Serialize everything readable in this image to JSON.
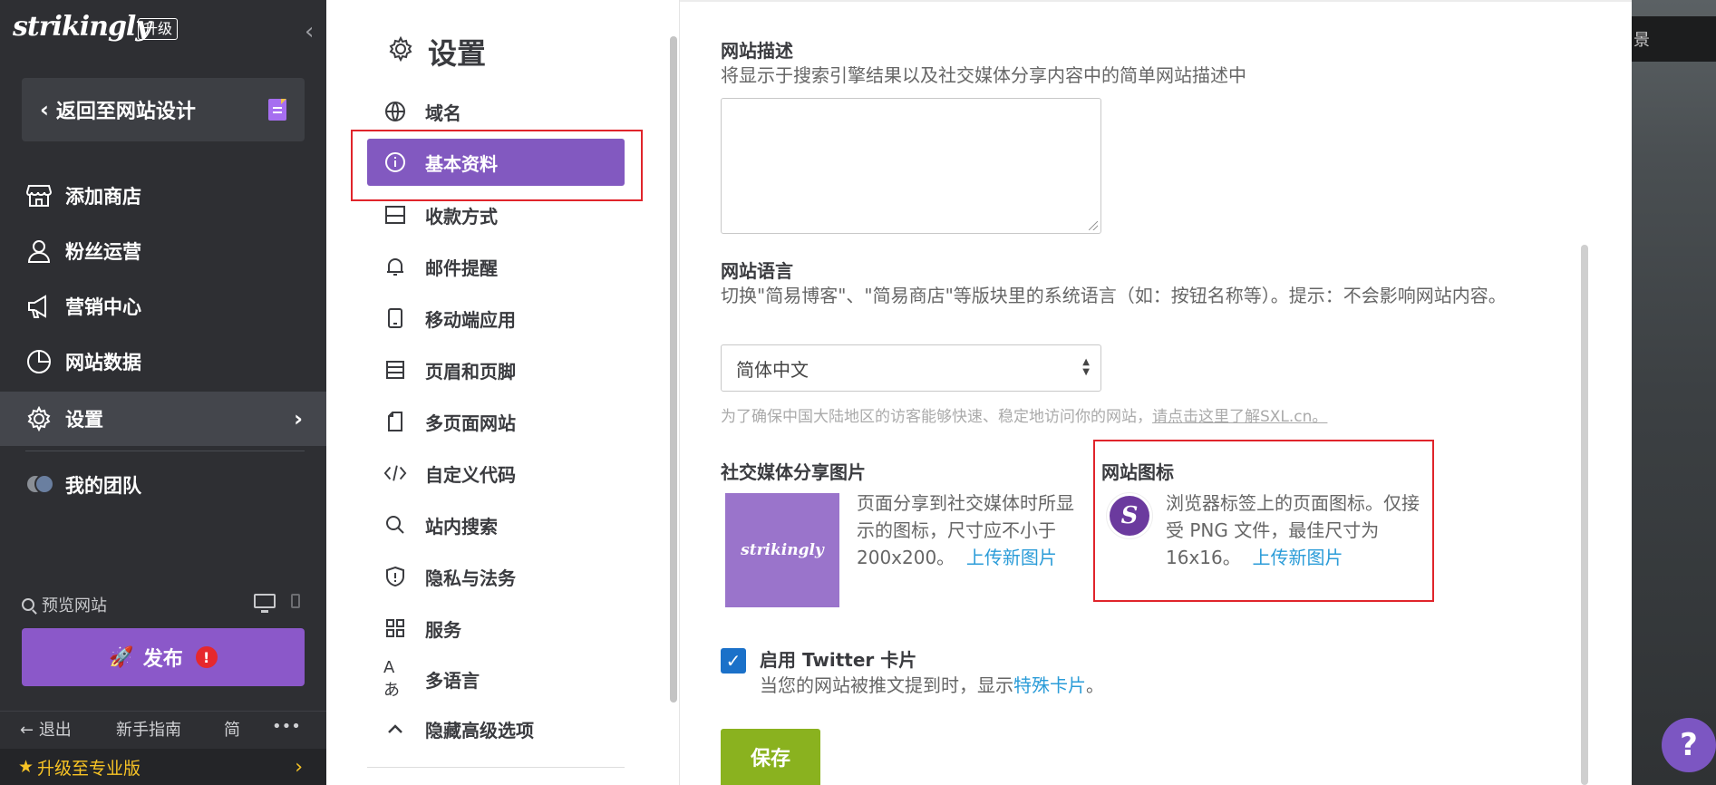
{
  "sidebar": {
    "logo": "strikingly",
    "upgrade_tag": "升级",
    "back_label": "返回至网站设计",
    "items": [
      {
        "label": "添加商店",
        "icon": "store-icon"
      },
      {
        "label": "粉丝运营",
        "icon": "audience-icon"
      },
      {
        "label": "营销中心",
        "icon": "megaphone-icon"
      },
      {
        "label": "网站数据",
        "icon": "pie-chart-icon"
      },
      {
        "label": "设置",
        "icon": "gear-icon"
      },
      {
        "label": "我的团队",
        "icon": "team-avatar-icon"
      }
    ],
    "preview_label": "预览网站",
    "publish_label": "发布",
    "publish_alert": "!",
    "bottom": {
      "exit": "退出",
      "guide": "新手指南",
      "lang": "简",
      "more": "•••"
    },
    "upgrade_pro": "升级至专业版"
  },
  "settings": {
    "title": "设置",
    "menu": [
      {
        "label": "域名",
        "icon": "globe-icon"
      },
      {
        "label": "基本资料",
        "icon": "info-icon"
      },
      {
        "label": "收款方式",
        "icon": "wallet-icon"
      },
      {
        "label": "邮件提醒",
        "icon": "bell-icon"
      },
      {
        "label": "移动端应用",
        "icon": "mobile-icon"
      },
      {
        "label": "页眉和页脚",
        "icon": "header-footer-icon"
      },
      {
        "label": "多页面网站",
        "icon": "pages-icon"
      },
      {
        "label": "自定义代码",
        "icon": "code-icon"
      },
      {
        "label": "站内搜索",
        "icon": "search-icon"
      },
      {
        "label": "隐私与法务",
        "icon": "shield-icon"
      },
      {
        "label": "服务",
        "icon": "grid-icon"
      },
      {
        "label": "多语言",
        "icon": "language-icon"
      },
      {
        "label": "隐藏高级选项",
        "icon": "chevron-up-icon"
      }
    ]
  },
  "form": {
    "desc_label": "网站描述",
    "desc_hint": "将显示于搜索引擎结果以及社交媒体分享内容中的简单网站描述中",
    "desc_value": "",
    "lang_label": "网站语言",
    "lang_hint": "切换\"简易博客\"、\"简易商店\"等版块里的系统语言（如：按钮名称等）。提示：不会影响网站内容。",
    "lang_value": "简体中文",
    "cn_hint": "为了确保中国大陆地区的访客能够快速、稳定地访问你的网站，",
    "cn_link": "请点击这里了解SXL.cn。",
    "share_label": "社交媒体分享图片",
    "share_thumb_text": "strikingly",
    "share_hint": "页面分享到社交媒体时所显示的图标，尺寸应不小于200x200。",
    "share_upload": "上传新图片",
    "favicon_label": "网站图标",
    "favicon_hint": "浏览器标签上的页面图标。仅接受 PNG 文件，最佳尺寸为 16x16。",
    "favicon_upload": "上传新图片",
    "favicon_letter": "S",
    "twitter_label": "启用 Twitter 卡片",
    "twitter_hint": "当您的网站被推文提到时，显示",
    "twitter_link": "特殊卡片",
    "twitter_end": "。",
    "twitter_checked": true,
    "save_label": "保存"
  },
  "preview": {
    "topbar_text": "景"
  },
  "help_label": "?",
  "colors": {
    "accent": "#8259c0",
    "publish": "#8b58c9",
    "save": "#8ab21f",
    "link": "#2b9cd8",
    "highlight_box": "#e0242b"
  }
}
